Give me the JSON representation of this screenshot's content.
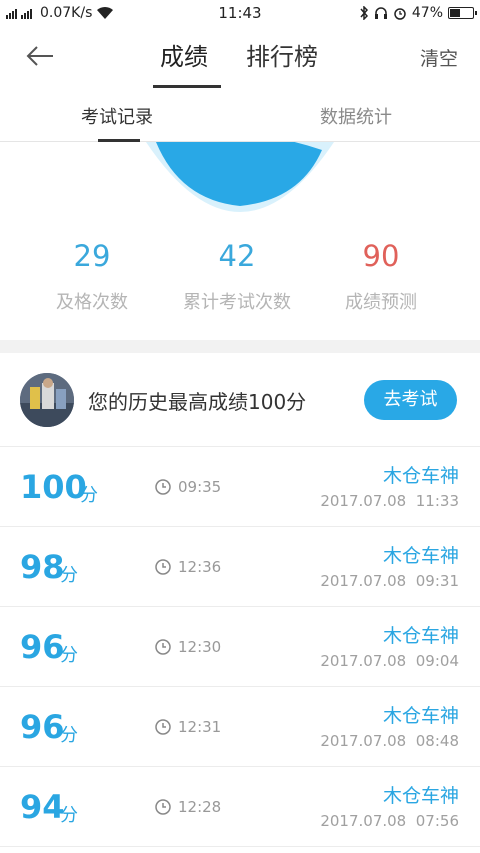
{
  "status_bar": {
    "network_speed": "0.07K/s",
    "time": "11:43",
    "battery": "47%",
    "battery_level": 0.47
  },
  "nav": {
    "tabs": [
      "成绩",
      "排行榜"
    ],
    "active_tab": "成绩",
    "clear_label": "清空"
  },
  "sub_tabs": {
    "items": [
      "考试记录",
      "数据统计"
    ],
    "active": "考试记录"
  },
  "gauge": {
    "color": "#29a8e6",
    "ring_color": "#d9f1fc"
  },
  "stats": [
    {
      "value": "29",
      "label": "及格次数",
      "color": "#3aa8dc"
    },
    {
      "value": "42",
      "label": "累计考试次数",
      "color": "#3aa8dc"
    },
    {
      "value": "90",
      "label": "成绩预测",
      "color": "#e0615a"
    }
  ],
  "best": {
    "text": "您的历史最高成绩100分",
    "button": "去考试"
  },
  "records": [
    {
      "score": "100",
      "unit": "分",
      "duration": "09:35",
      "name": "木仓车神",
      "date": "2017.07.08  11:33"
    },
    {
      "score": "98",
      "unit": "分",
      "duration": "12:36",
      "name": "木仓车神",
      "date": "2017.07.08  09:31"
    },
    {
      "score": "96",
      "unit": "分",
      "duration": "12:30",
      "name": "木仓车神",
      "date": "2017.07.08  09:04"
    },
    {
      "score": "96",
      "unit": "分",
      "duration": "12:31",
      "name": "木仓车神",
      "date": "2017.07.08  08:48"
    },
    {
      "score": "94",
      "unit": "分",
      "duration": "12:28",
      "name": "木仓车神",
      "date": "2017.07.08  07:56"
    }
  ]
}
